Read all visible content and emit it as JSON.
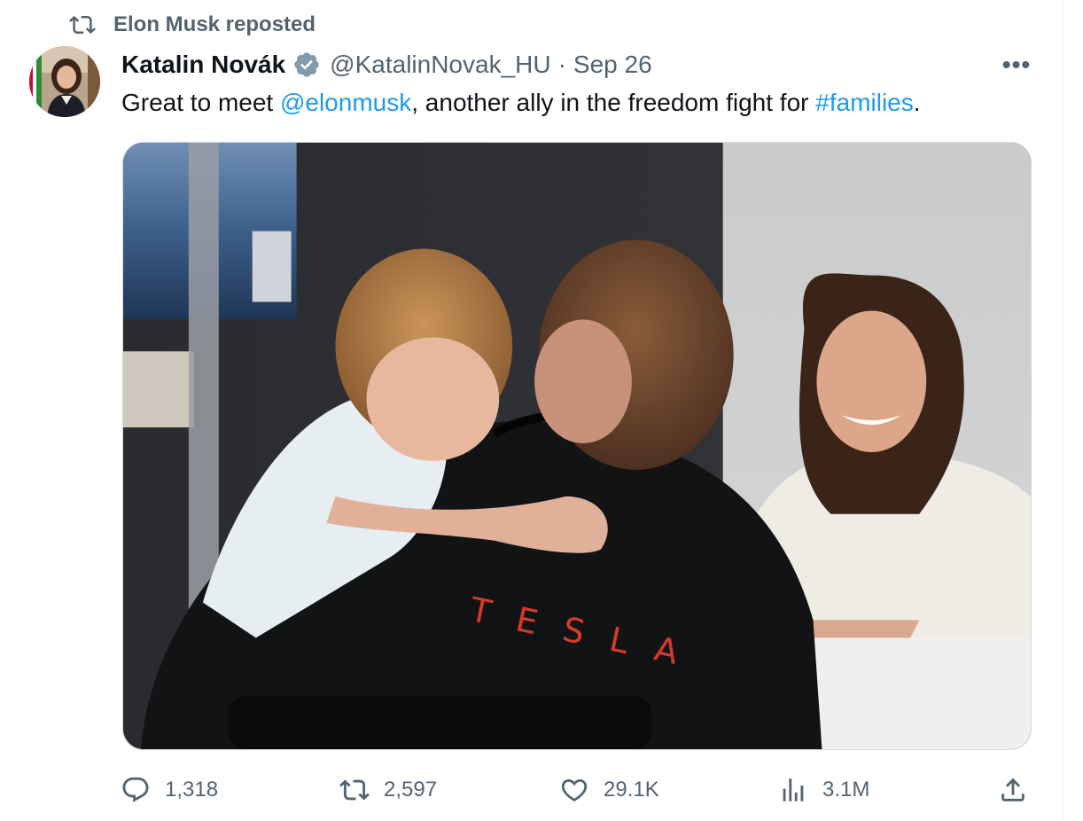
{
  "repost_context": {
    "label": "Elon Musk reposted",
    "icon": "repost-icon"
  },
  "author": {
    "display_name": "Katalin Novák",
    "verified": true,
    "handle": "@KatalinNovak_HU",
    "separator": "·",
    "date": "Sep 26"
  },
  "more_menu": {
    "icon": "more-icon",
    "label": "•••"
  },
  "tweet": {
    "text_before": "Great to meet ",
    "mention": "@elonmusk",
    "text_middle": ", another ally in the freedom fight for ",
    "hashtag": "#families",
    "text_after": "."
  },
  "media": {
    "shirt_text": "TESLA"
  },
  "actions": {
    "replies": "1,318",
    "reposts": "2,597",
    "likes": "29.1K",
    "views": "3.1M"
  },
  "colors": {
    "accent": "#1d9bf0",
    "secondary_text": "#536471",
    "verified": "#829aab"
  }
}
